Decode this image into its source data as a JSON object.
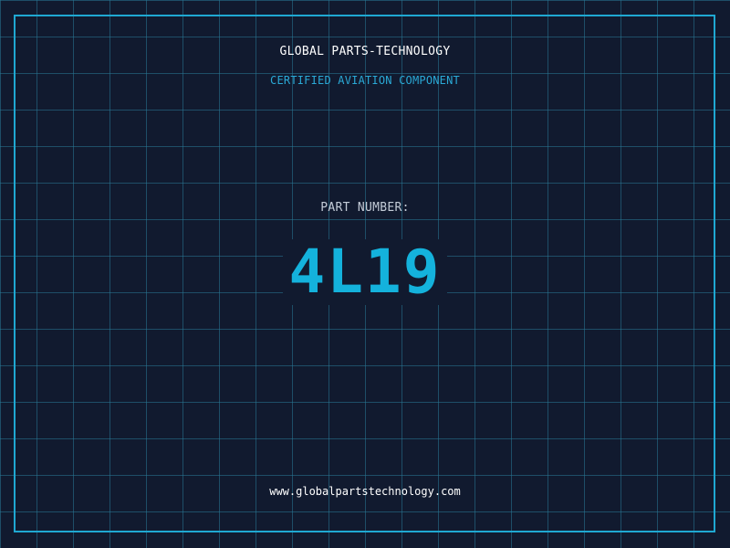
{
  "brand": {
    "name": "GLOBAL PARTS-TECHNOLOGY",
    "tagline": "CERTIFIED AVIATION COMPONENT"
  },
  "part": {
    "label": "PART NUMBER:",
    "number": "4L19"
  },
  "footer": {
    "website": "www.globalpartstechnology.com"
  },
  "colors": {
    "background": "#111a2f",
    "grid": "#28789a",
    "frame": "#1fa8d2",
    "accent": "#14b2dc",
    "tagline": "#2aa9d6",
    "label": "#c4ccd8",
    "text": "#ffffff"
  }
}
